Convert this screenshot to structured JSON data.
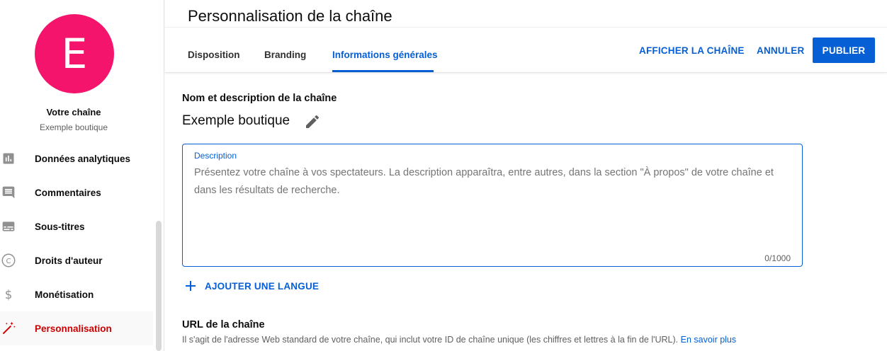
{
  "sidebar": {
    "avatar_letter": "E",
    "avatar_color": "#f4146c",
    "channel_title": "Votre chaîne",
    "channel_name": "Exemple boutique",
    "items": [
      {
        "label": "Données analytiques",
        "icon": "bar-chart-icon"
      },
      {
        "label": "Commentaires",
        "icon": "comment-icon"
      },
      {
        "label": "Sous-titres",
        "icon": "subtitles-icon"
      },
      {
        "label": "Droits d'auteur",
        "icon": "copyright-icon"
      },
      {
        "label": "Monétisation",
        "icon": "dollar-icon"
      },
      {
        "label": "Personnalisation",
        "icon": "magic-wand-icon",
        "active": true
      }
    ]
  },
  "header": {
    "title": "Personnalisation de la chaîne",
    "tabs": [
      {
        "label": "Disposition"
      },
      {
        "label": "Branding"
      },
      {
        "label": "Informations générales",
        "active": true
      }
    ],
    "view_channel_label": "AFFICHER LA CHAÎNE",
    "cancel_label": "ANNULER",
    "publish_label": "PUBLIER"
  },
  "main": {
    "name_section_heading": "Nom et description de la chaîne",
    "channel_name": "Exemple boutique",
    "description": {
      "label": "Description",
      "placeholder": "Présentez votre chaîne à vos spectateurs. La description apparaîtra, entre autres, dans la section \"À propos\" de votre chaîne et dans les résultats de recherche.",
      "value": "",
      "char_count": "0/1000"
    },
    "add_language_label": "AJOUTER UNE LANGUE",
    "url_section_heading": "URL de la chaîne",
    "url_note": "Il s'agit de l'adresse Web standard de votre chaîne, qui inclut votre ID de chaîne unique (les chiffres et lettres à la fin de l'URL).",
    "learn_more_label": "En savoir plus"
  },
  "colors": {
    "accent": "#065fd4",
    "active_nav": "#cc0000"
  }
}
